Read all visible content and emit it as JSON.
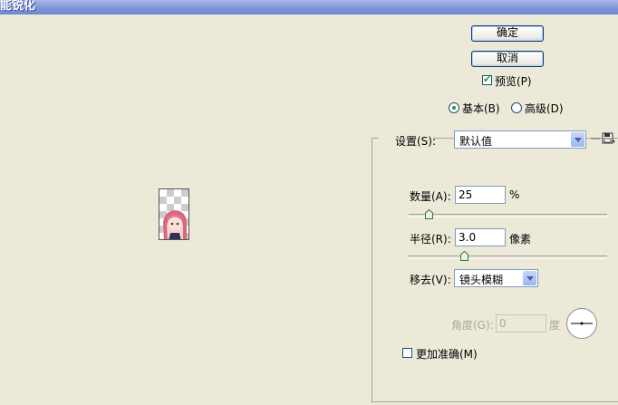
{
  "window": {
    "title": "能锐化"
  },
  "buttons": {
    "ok": "确定",
    "cancel": "取消"
  },
  "preview": {
    "label": "预览(P)",
    "checked": true
  },
  "mode": {
    "basic": "基本(B)",
    "advanced": "高级(D)",
    "selected": "basic"
  },
  "settings": {
    "label": "设置(S):",
    "value": "默认值"
  },
  "amount": {
    "label": "数量(A):",
    "value": "25",
    "unit": "%",
    "slider_fraction": 0.1
  },
  "radius": {
    "label": "半径(R):",
    "value": "3.0",
    "unit": "像素",
    "slider_fraction": 0.28
  },
  "remove": {
    "label": "移去(V):",
    "value": "镜头模糊"
  },
  "angle": {
    "label": "角度(G):",
    "value": "0",
    "unit": "度"
  },
  "more_accurate": {
    "label": "更加准确(M)",
    "checked": false
  },
  "colors": {
    "titlebar": "#7f95da",
    "dialog_bg": "#ece9d8",
    "check": "#21a121"
  }
}
